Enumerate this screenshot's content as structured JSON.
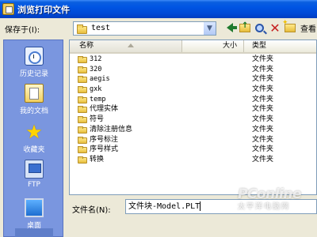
{
  "window": {
    "title": "浏览打印文件"
  },
  "save_in": {
    "label": "保存于(I):",
    "value": "test"
  },
  "toolbar": {
    "view_label": "查看"
  },
  "places": [
    {
      "label": "历史记录"
    },
    {
      "label": "我的文档"
    },
    {
      "label": "收藏夹"
    },
    {
      "label": "FTP"
    },
    {
      "label": "桌面"
    }
  ],
  "file_list": {
    "columns": {
      "name": "名称",
      "size": "大小",
      "type": "类型"
    },
    "rows": [
      {
        "name": "312",
        "size": "",
        "type": "文件夹"
      },
      {
        "name": "320",
        "size": "",
        "type": "文件夹"
      },
      {
        "name": "aegis",
        "size": "",
        "type": "文件夹"
      },
      {
        "name": "gxk",
        "size": "",
        "type": "文件夹"
      },
      {
        "name": "temp",
        "size": "",
        "type": "文件夹"
      },
      {
        "name": "代理实体",
        "size": "",
        "type": "文件夹"
      },
      {
        "name": "符号",
        "size": "",
        "type": "文件夹"
      },
      {
        "name": "清除注册信息",
        "size": "",
        "type": "文件夹"
      },
      {
        "name": "序号标注",
        "size": "",
        "type": "文件夹"
      },
      {
        "name": "序号样式",
        "size": "",
        "type": "文件夹"
      },
      {
        "name": "转换",
        "size": "",
        "type": "文件夹"
      }
    ]
  },
  "filename": {
    "label": "文件名(N):",
    "value": "文件块-Model.PLT"
  },
  "watermark": {
    "main": "PConline",
    "sub": "太平洋电脑网"
  },
  "colors": {
    "titlebar": "#0054e3",
    "places_bar": "#7a96df",
    "dialog_bg": "#ece9d8"
  }
}
